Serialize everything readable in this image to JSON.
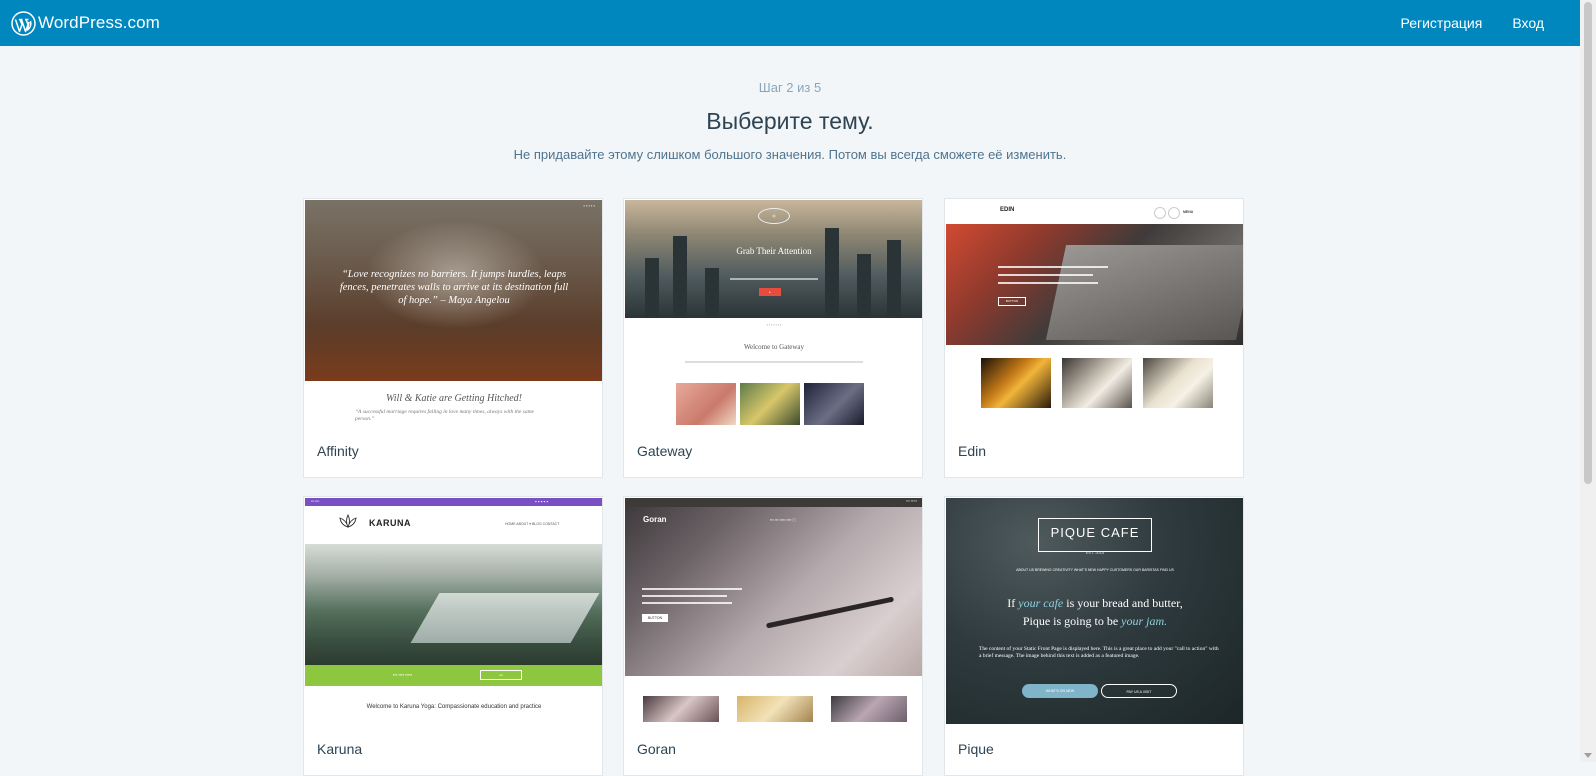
{
  "header": {
    "brand": "WordPress.com",
    "signup": "Регистрация",
    "login": "Вход"
  },
  "main": {
    "step": "Шаг 2 из 5",
    "title": "Выберите тему.",
    "subtitle": "Не придавайте этому слишком большого значения. Потом вы всегда сможете её изменить."
  },
  "themes": [
    {
      "name": "Affinity",
      "preview": {
        "quote": "“Love recognizes no barriers. It jumps hurdles, leaps fences, penetrates walls to arrive at its destination full of hope.” – Maya Angelou",
        "heading": "Will & Katie are Getting Hitched!",
        "sub": "“A successful marriage requires falling in love many times, always with the same person.”"
      }
    },
    {
      "name": "Gateway",
      "preview": {
        "title": "Grab Their Attention",
        "welcome": "Welcome to Gateway"
      }
    },
    {
      "name": "Edin",
      "preview": {
        "logo": "EDIN",
        "menu": "MENU",
        "button": "BUTTON"
      }
    },
    {
      "name": "Karuna",
      "preview": {
        "logo": "KARUNA",
        "nav": "HOME   ABOUT ▾   BLOG   CONTACT",
        "welcome": "Welcome to Karuna Yoga: Compassionate education and practice"
      }
    },
    {
      "name": "Goran",
      "preview": {
        "logo": "Goran",
        "button": "BUTTON"
      }
    },
    {
      "name": "Pique",
      "preview": {
        "logo": "PIQUE CAFE",
        "est": "EST. 2015",
        "nav": "ABOUT US    BREWING    CREATIVITY    WHAT'S NEW    HAPPY CUSTOMERS    OUR BARISTAS    FIND US",
        "slogan_1": "If ",
        "slogan_em1": "your cafe",
        "slogan_2": " is your bread and butter,",
        "slogan_3": "Pique is going to be ",
        "slogan_em2": "your jam.",
        "body": "The content of your Static Front Page is displayed here. This is a great place to add your \"call to action\" with a brief message. The image behind this text is added as a featured image.",
        "btn1": "WHAT'S ON NEW",
        "btn2": "PAY US A VISIT"
      }
    }
  ],
  "colors": {
    "header_bg": "#0087be",
    "page_bg": "#f3f6f8",
    "text": "#2e4453"
  }
}
